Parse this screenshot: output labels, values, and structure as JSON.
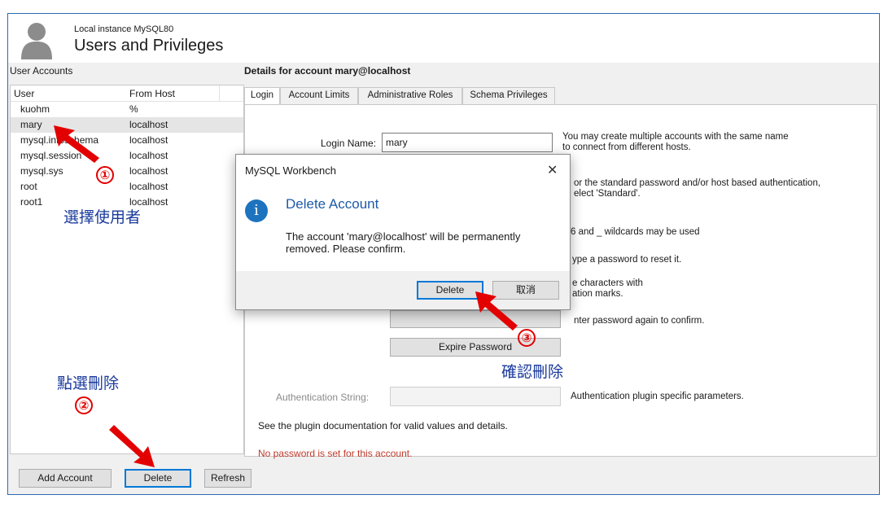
{
  "header": {
    "instance": "Local instance MySQL80",
    "title": "Users and Privileges"
  },
  "left": {
    "caption": "User Accounts",
    "columns": {
      "user": "User",
      "host": "From Host"
    },
    "rows": [
      {
        "user": "kuohm",
        "host": "%"
      },
      {
        "user": "mary",
        "host": "localhost",
        "selected": true
      },
      {
        "user": "mysql.infoschema",
        "host": "localhost"
      },
      {
        "user": "mysql.session",
        "host": "localhost"
      },
      {
        "user": "mysql.sys",
        "host": "localhost"
      },
      {
        "user": "root",
        "host": "localhost"
      },
      {
        "user": "root1",
        "host": "localhost"
      }
    ]
  },
  "buttons": {
    "add": "Add Account",
    "delete": "Delete",
    "refresh": "Refresh",
    "expire": "Expire Password"
  },
  "details": {
    "caption": "Details for account mary@localhost",
    "tabs": [
      "Login",
      "Account Limits",
      "Administrative Roles",
      "Schema Privileges"
    ],
    "login_name_label": "Login Name:",
    "login_name_value": "mary",
    "hint1": "You may create multiple accounts with the same name\nto connect from different hosts.",
    "hint2": "or the standard password and/or host based authentication,\nelect 'Standard'.",
    "hint3": "6 and _ wildcards may be used",
    "hint4": "ype a password to reset it.",
    "hint5": "e characters with\nation marks.",
    "hint6": "nter password again to confirm.",
    "auth_string_label": "Authentication String:",
    "auth_hint": "Authentication plugin specific parameters.",
    "plugin_note": "See the plugin documentation for valid values and details.",
    "no_password": "No password is set for this account."
  },
  "dialog": {
    "window_title": "MySQL Workbench",
    "close_glyph": "✕",
    "icon_glyph": "i",
    "heading": "Delete Account",
    "message": "The account 'mary@localhost' will be permanently removed. Please confirm.",
    "ok": "Delete",
    "cancel": "取消"
  },
  "annotations": {
    "step1": "①",
    "step1_text": "選擇使用者",
    "step2": "②",
    "step2_text": "點選刪除",
    "step3": "③",
    "step3_text": "確認刪除",
    "arrow_color": "#e30000",
    "text_color": "#1a3a9c"
  }
}
